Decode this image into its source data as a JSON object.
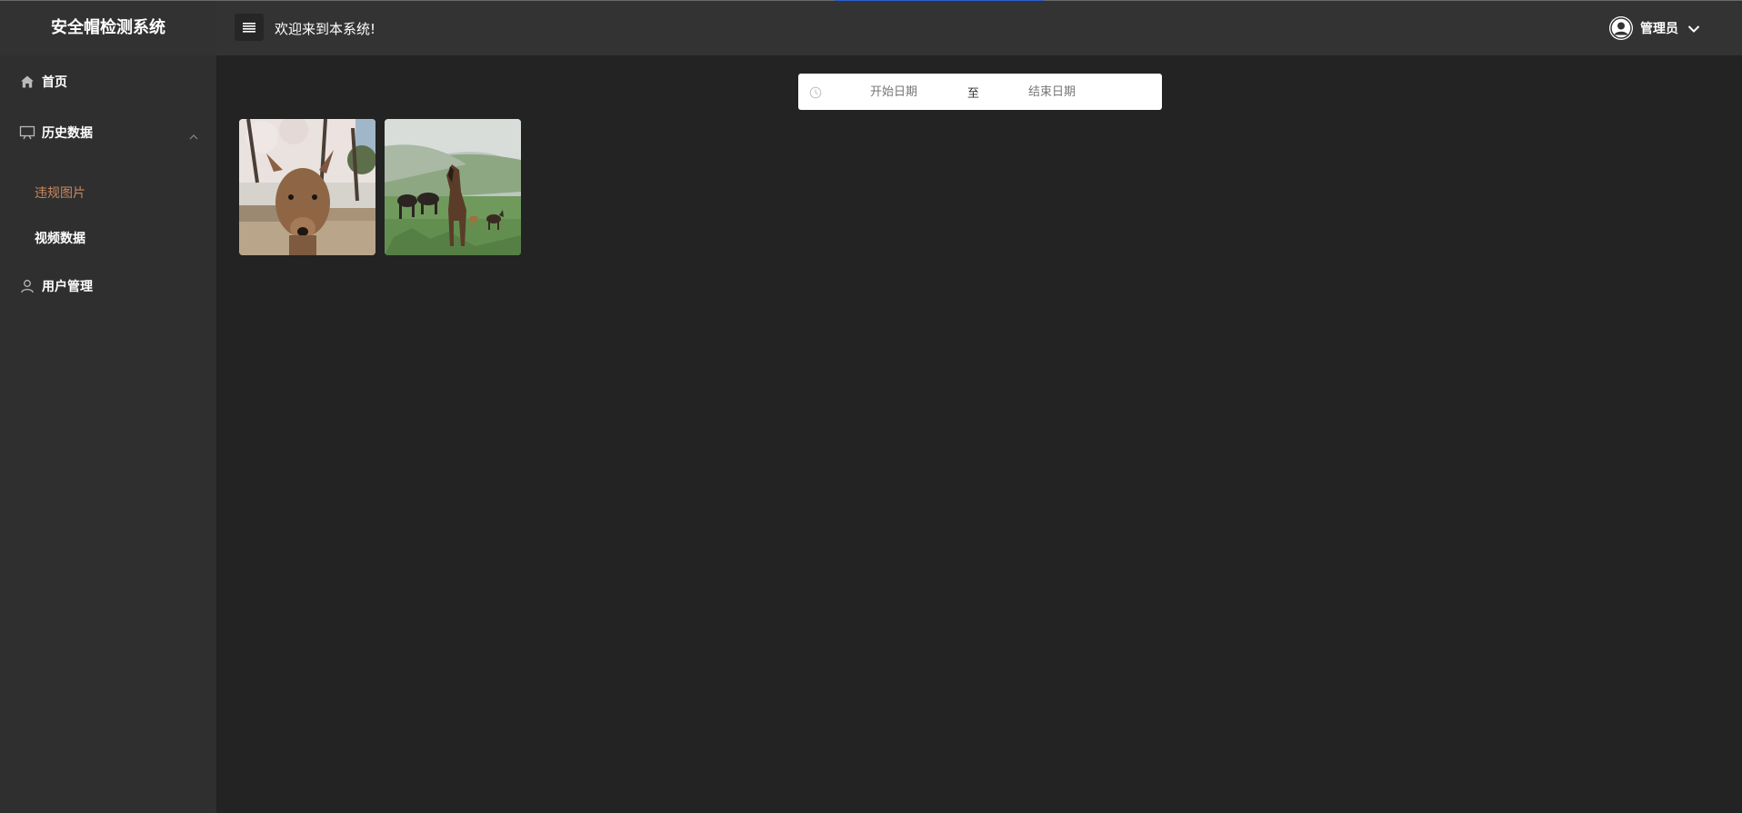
{
  "app": {
    "title": "安全帽检测系统"
  },
  "header": {
    "welcome": "欢迎来到本系统!",
    "user_name": "管理员"
  },
  "sidebar": {
    "items": [
      {
        "label": "首页",
        "icon": "home-icon"
      },
      {
        "label": "历史数据",
        "icon": "monitor-icon",
        "expanded": true,
        "children": [
          {
            "label": "违规图片",
            "active": true
          },
          {
            "label": "视频数据",
            "active": false
          }
        ]
      },
      {
        "label": "用户管理",
        "icon": "user-icon"
      }
    ]
  },
  "filter": {
    "start_placeholder": "开始日期",
    "separator": "至",
    "end_placeholder": "结束日期"
  },
  "gallery": {
    "images": [
      {
        "subject": "deer-photo"
      },
      {
        "subject": "horses-photo"
      }
    ]
  },
  "colors": {
    "sidebar_bg": "#2f2f2f",
    "header_bg": "#333333",
    "main_bg": "#232323",
    "active_sub_item": "#c8875e",
    "progress_accent": "#2b5fd0"
  }
}
